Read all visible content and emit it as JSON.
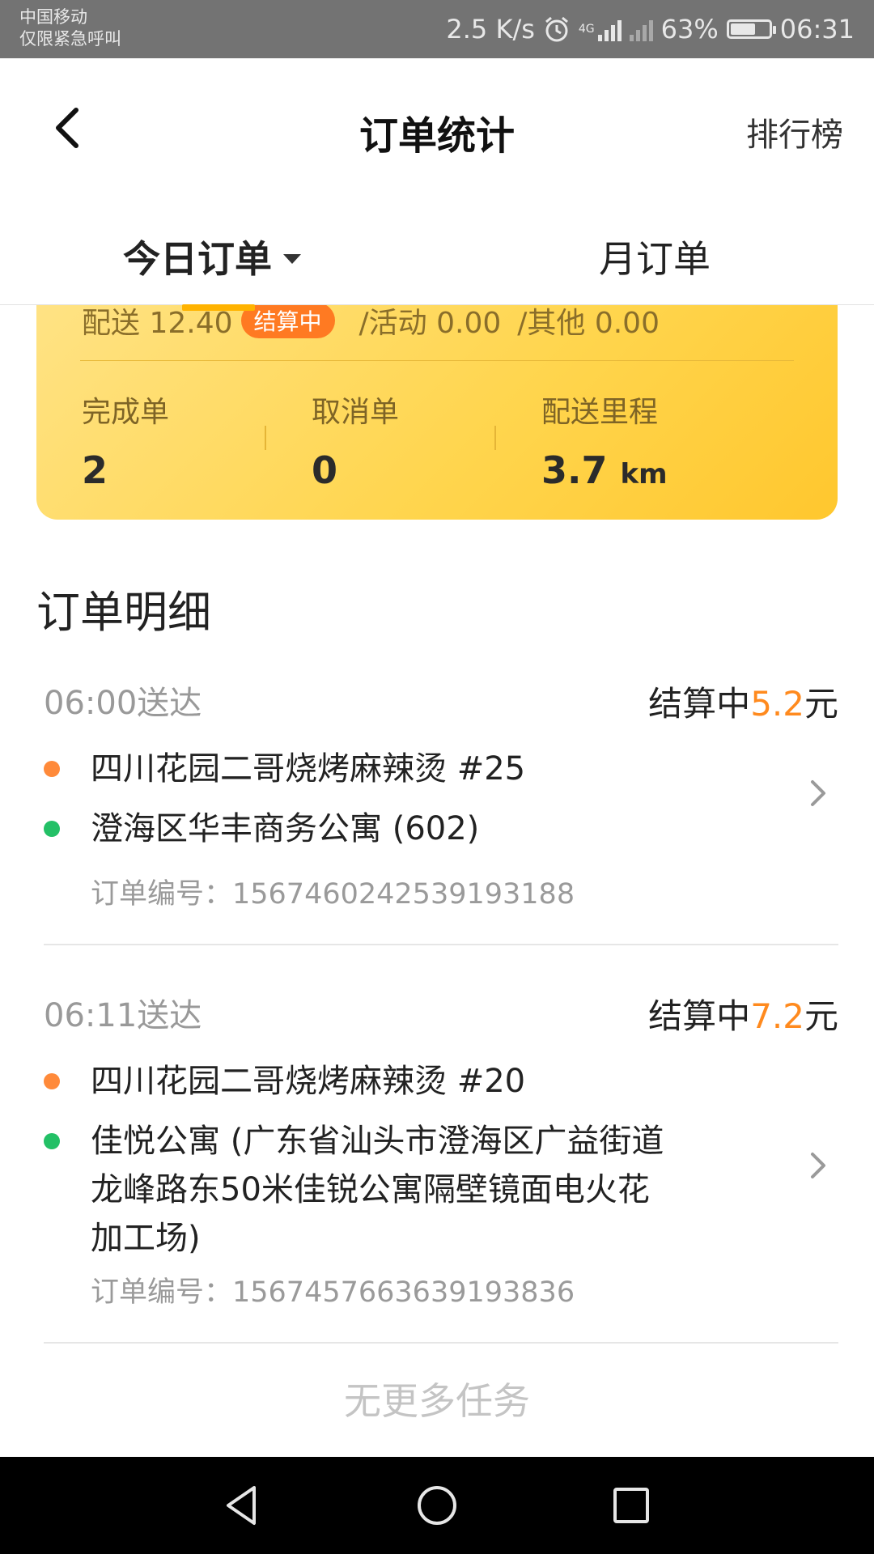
{
  "status_bar": {
    "carrier_line1": "中国移动",
    "carrier_line2": "仅限紧急呼叫",
    "net_speed": "2.5 K/s",
    "net_tag": "4G",
    "battery_pct": "63%",
    "time": "06:31"
  },
  "header": {
    "title": "订单统计",
    "right_action": "排行榜"
  },
  "tabs": {
    "today": "今日订单",
    "month": "月订单"
  },
  "summary": {
    "delivery_label": "配送 12.40",
    "settling_badge": "结算中",
    "activity": "/活动 0.00",
    "other": "/其他 0.00",
    "completed_label": "完成单",
    "completed_value": "2",
    "canceled_label": "取消单",
    "canceled_value": "0",
    "distance_label": "配送里程",
    "distance_value": "3.7",
    "distance_unit": "km"
  },
  "details": {
    "title": "订单明细",
    "orders": [
      {
        "time": "06:00送达",
        "status": "结算中",
        "amount": "5.2",
        "currency": "元",
        "shop": "四川花园二哥烧烤麻辣烫 #25",
        "address": "澄海区华丰商务公寓 (602)",
        "order_no": "订单编号：1567460242539193188"
      },
      {
        "time": "06:11送达",
        "status": "结算中",
        "amount": "7.2",
        "currency": "元",
        "shop": "四川花园二哥烧烤麻辣烫 #20",
        "address_lines": [
          "佳悦公寓 (广东省汕头市澄海区广益街道",
          "龙峰路东50米佳锐公寓隔壁镜面电火花",
          "加工场)"
        ],
        "order_no": "订单编号：1567457663639193836"
      }
    ],
    "no_more": "无更多任务"
  },
  "colors": {
    "accent": "#ffb300",
    "amount": "#ff8a1e",
    "badge": "#ff7a22",
    "pickup_dot": "#ff8a3a",
    "dropoff_dot": "#23c066"
  },
  "icons": [
    "back-icon",
    "caret-down-icon",
    "chevron-right-icon",
    "alarm-icon",
    "signal-icon",
    "battery-icon",
    "nav-back-icon",
    "nav-home-icon",
    "nav-recents-icon"
  ]
}
